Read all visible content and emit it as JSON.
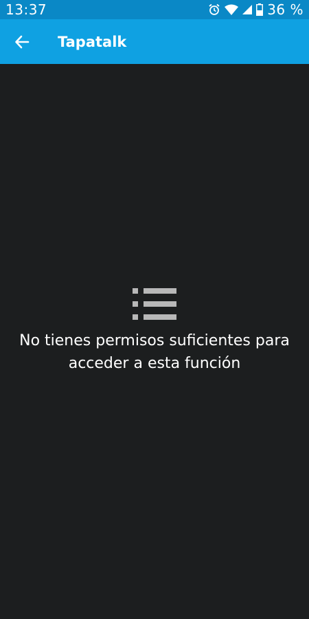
{
  "status_bar": {
    "time": "13:37",
    "battery": "36 %",
    "icons": [
      "alarm-icon",
      "wifi-icon",
      "cell-signal-icon",
      "battery-icon"
    ]
  },
  "app_bar": {
    "title": "Tapatalk",
    "back_icon": "arrow-left-icon"
  },
  "empty_state": {
    "icon": "list-icon",
    "message": "No tienes permisos suficientes para acceder a esta función"
  },
  "colors": {
    "status_bar": "#0a88c6",
    "app_bar": "#0fa1e2",
    "background": "#1c1e1f",
    "icon_grey": "#b8b8b8",
    "text": "#ffffff"
  }
}
